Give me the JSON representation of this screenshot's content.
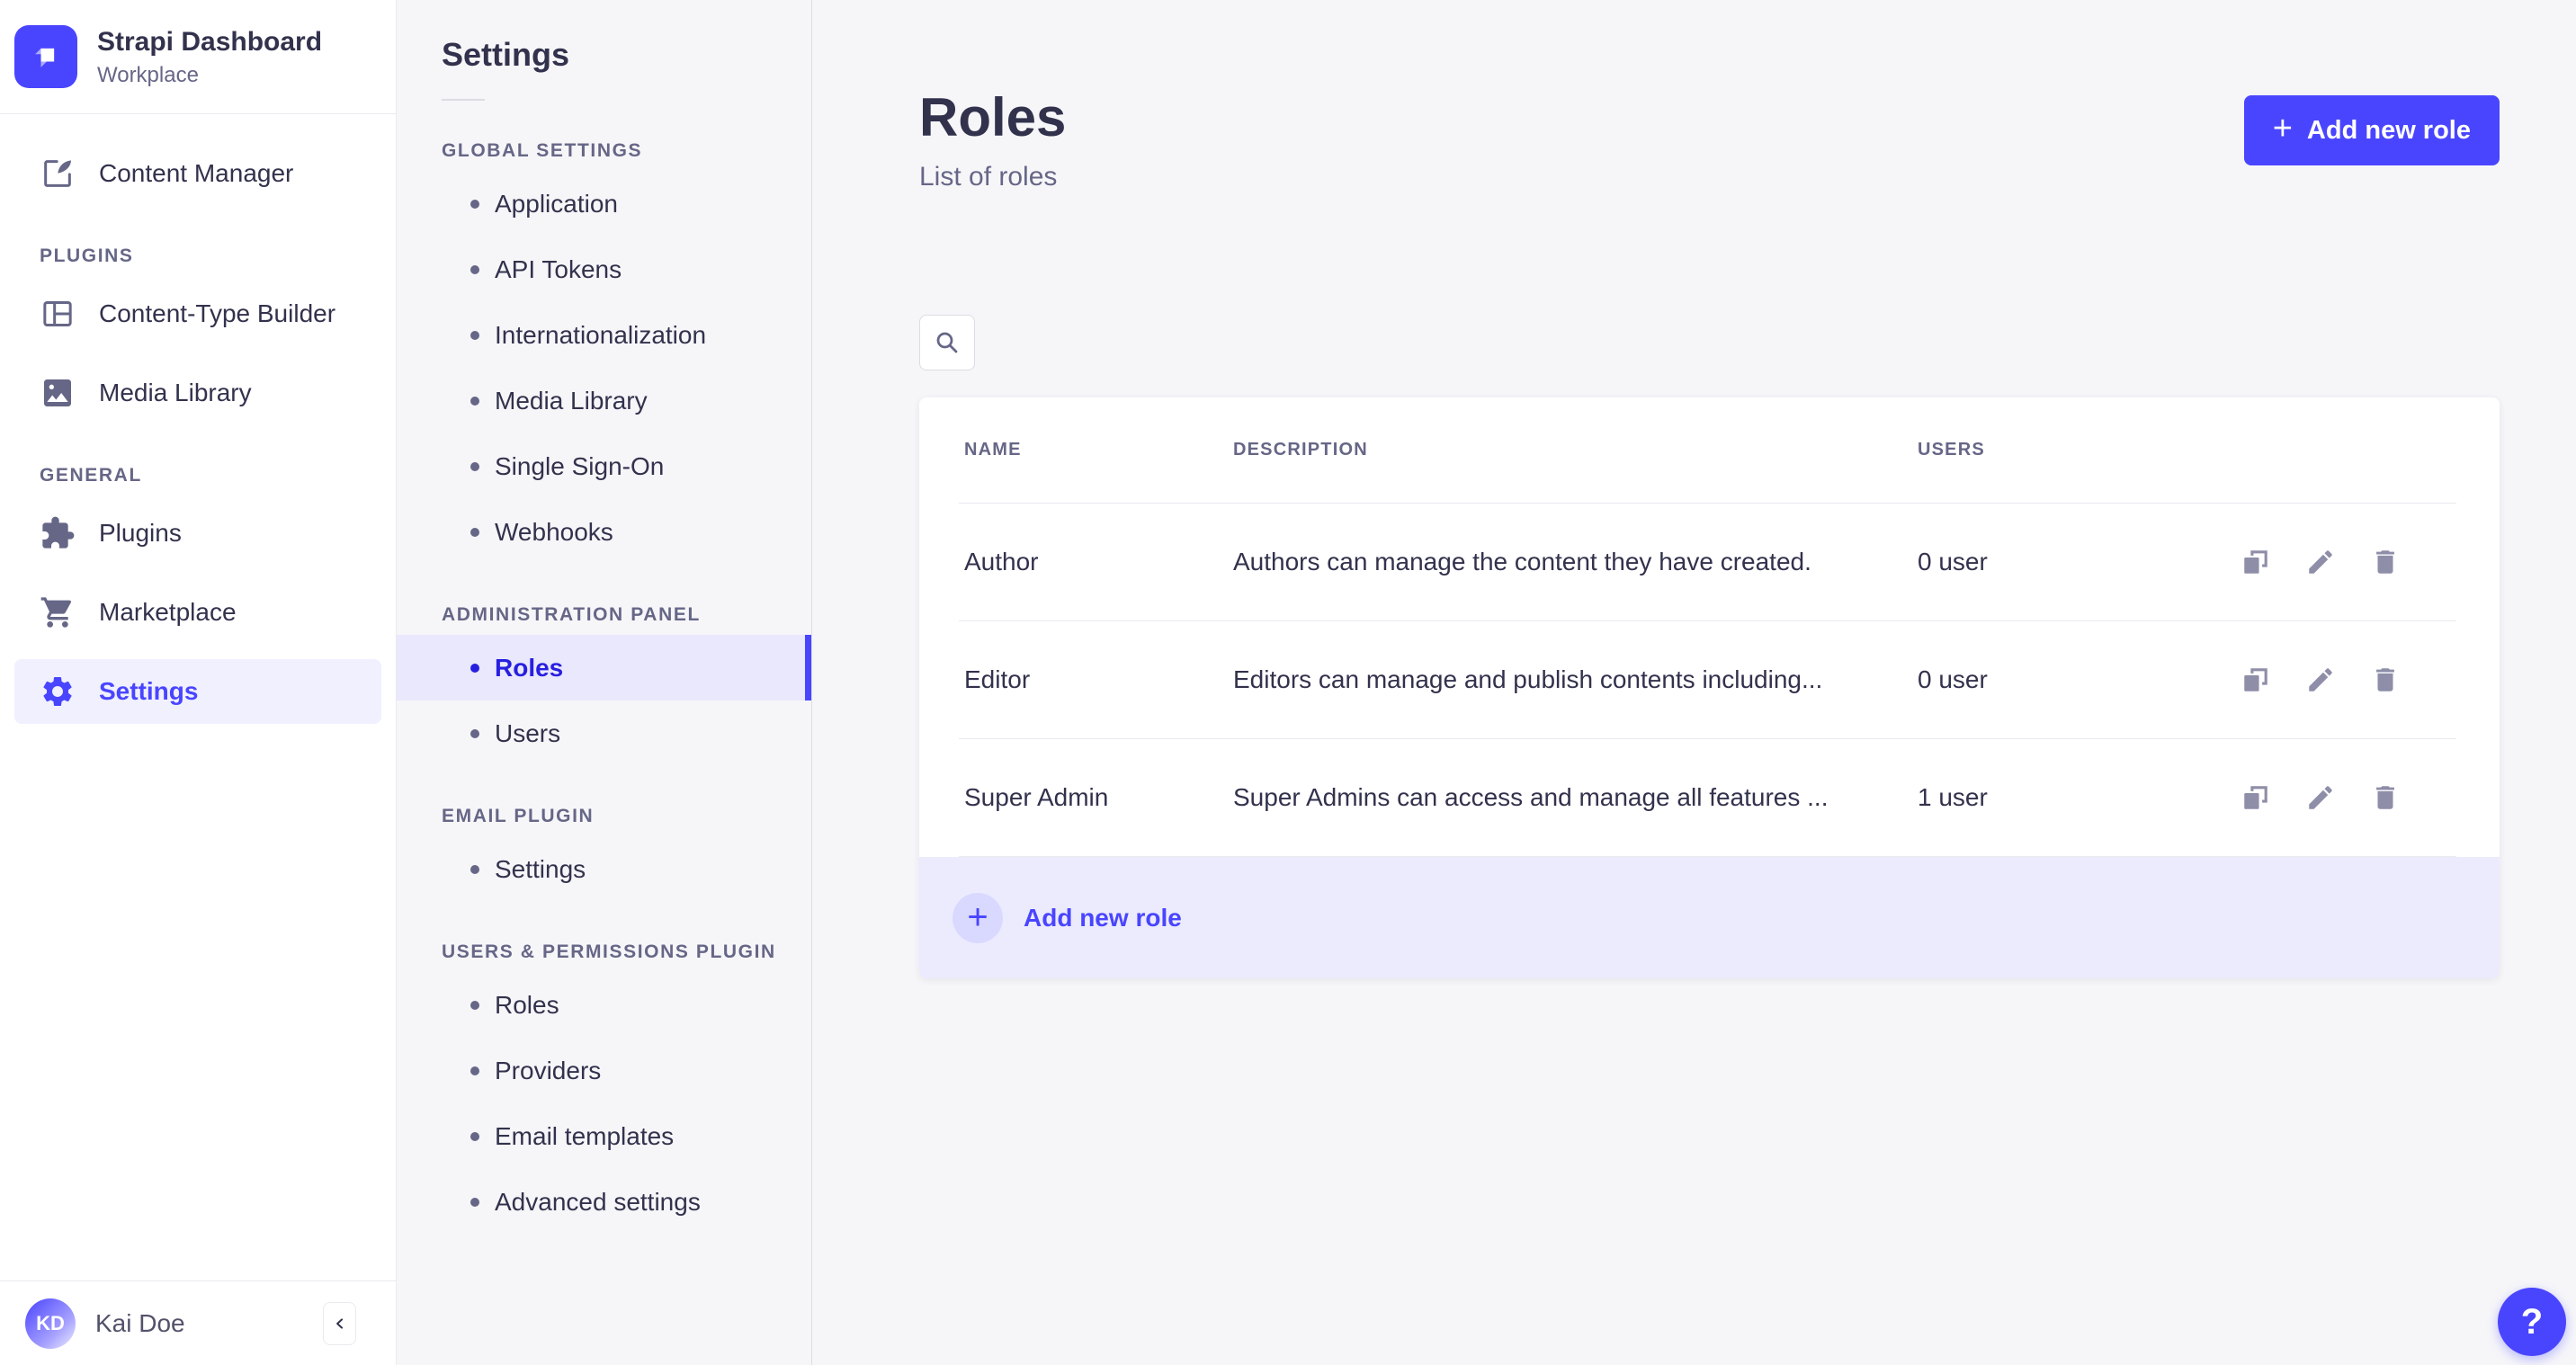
{
  "colors": {
    "primary": "#4945ff",
    "primary_dark_text": "#271fe0",
    "primary_light_bg": "#f0f0ff",
    "subnav_active_bg": "#e9e8fc",
    "footer_row_bg": "#ecebfd",
    "text_dark": "#32324d",
    "text_muted": "#666687",
    "icon_gray": "#8e8ea9",
    "page_bg": "#f6f6f9",
    "border": "#dcdce4"
  },
  "brand": {
    "title": "Strapi Dashboard",
    "subtitle": "Workplace"
  },
  "sidebar": {
    "content_manager": {
      "label": "Content Manager"
    },
    "sections": [
      {
        "header": "PLUGINS",
        "items": [
          {
            "label": "Content-Type Builder"
          },
          {
            "label": "Media Library"
          }
        ]
      },
      {
        "header": "GENERAL",
        "items": [
          {
            "label": "Plugins"
          },
          {
            "label": "Marketplace"
          },
          {
            "label": "Settings"
          }
        ]
      }
    ],
    "user": {
      "initials": "KD",
      "name": "Kai Doe"
    }
  },
  "subnav": {
    "title": "Settings",
    "sections": [
      {
        "header": "GLOBAL SETTINGS",
        "items": [
          {
            "label": "Application"
          },
          {
            "label": "API Tokens"
          },
          {
            "label": "Internationalization"
          },
          {
            "label": "Media Library"
          },
          {
            "label": "Single Sign-On"
          },
          {
            "label": "Webhooks"
          }
        ]
      },
      {
        "header": "ADMINISTRATION PANEL",
        "items": [
          {
            "label": "Roles",
            "active": true
          },
          {
            "label": "Users"
          }
        ]
      },
      {
        "header": "EMAIL PLUGIN",
        "items": [
          {
            "label": "Settings"
          }
        ]
      },
      {
        "header": "USERS & PERMISSIONS PLUGIN",
        "items": [
          {
            "label": "Roles"
          },
          {
            "label": "Providers"
          },
          {
            "label": "Email templates"
          },
          {
            "label": "Advanced settings"
          }
        ]
      }
    ]
  },
  "main": {
    "title": "Roles",
    "subtitle": "List of roles",
    "add_button_label": "Add new role",
    "add_button_plus": "+",
    "table": {
      "columns": {
        "name": "NAME",
        "description": "DESCRIPTION",
        "users": "USERS"
      },
      "rows": [
        {
          "name": "Author",
          "description": "Authors can manage the content they have created.",
          "users": "0 user"
        },
        {
          "name": "Editor",
          "description": "Editors can manage and publish contents including...",
          "users": "0 user"
        },
        {
          "name": "Super Admin",
          "description": "Super Admins can access and manage all features ...",
          "users": "1 user"
        }
      ],
      "footer_action_label": "Add new role",
      "footer_action_plus": "+"
    },
    "help_label": "?"
  }
}
